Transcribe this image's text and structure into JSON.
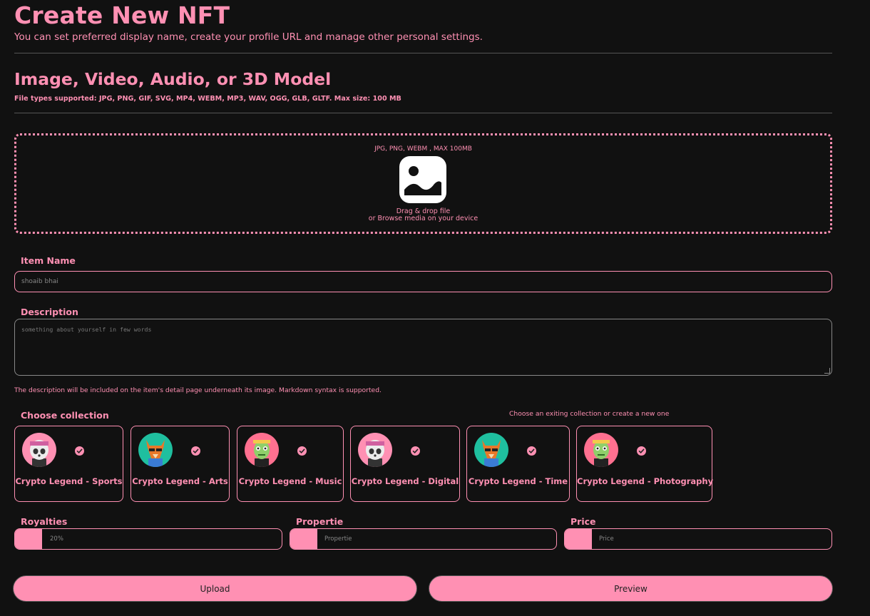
{
  "header": {
    "title": "Create New NFT",
    "subtitle": "You can set preferred display name, create your profile URL and manage other personal settings."
  },
  "media_section": {
    "title": "Image, Video, Audio, or 3D Model",
    "supported": "File types supported: JPG, PNG, GIF, SVG, MP4, WEBM, MP3, WAV, OGG, GLB, GLTF. Max size: 100 MB"
  },
  "dropzone": {
    "types": "JPG, PNG, WEBM , MAX 100MB",
    "line1": "Drag & drop file",
    "line2": "or Browse media on your device",
    "icon": "image-icon"
  },
  "item_name": {
    "label": "Item Name",
    "value": "shoaib bhai"
  },
  "description": {
    "label": "Description",
    "placeholder": "something about yourself in few words",
    "note": "The description will be included on the item's detail page underneath its image. Markdown syntax is supported."
  },
  "collection": {
    "label": "Choose collection",
    "hint": "Choose an exiting collection or create a new one",
    "items": [
      {
        "name": "Crypto Legend - Sports",
        "avatar": "panda-avatar",
        "checked": true
      },
      {
        "name": "Crypto Legend - Arts",
        "avatar": "fox-avatar",
        "checked": true
      },
      {
        "name": "Crypto Legend - Music",
        "avatar": "lizard-avatar",
        "checked": true
      },
      {
        "name": "Crypto Legend - Digital",
        "avatar": "panda-avatar",
        "checked": true
      },
      {
        "name": "Crypto Legend - Time",
        "avatar": "fox-avatar",
        "checked": true
      },
      {
        "name": "Crypto Legend - Photography",
        "avatar": "lizard-avatar",
        "checked": true
      }
    ]
  },
  "royalties": {
    "label": "Royalties",
    "value": "20%"
  },
  "propertie": {
    "label": "Propertie",
    "placeholder": "Propertie"
  },
  "price": {
    "label": "Price",
    "placeholder": "Price"
  },
  "buttons": {
    "upload": "Upload",
    "preview": "Preview"
  },
  "colors": {
    "accent": "#ff90b3",
    "background": "#111111"
  }
}
